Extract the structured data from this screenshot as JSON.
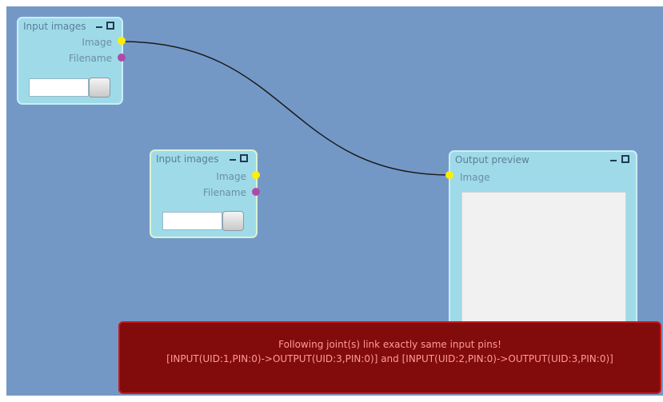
{
  "nodes": {
    "input1": {
      "title": "Input images",
      "pins": [
        "Image",
        "Filename"
      ]
    },
    "input2": {
      "title": "Input images",
      "pins": [
        "Image",
        "Filename"
      ]
    },
    "output": {
      "title": "Output preview",
      "pins": [
        "Image"
      ]
    }
  },
  "error": {
    "line1": "Following joint(s) link exactly same input pins!",
    "line2": "[INPUT(UID:1,PIN:0)->OUTPUT(UID:3,PIN:0)] and [INPUT(UID:2,PIN:0)->OUTPUT(UID:3,PIN:0)]"
  },
  "colors": {
    "canvas": "#7498c6",
    "node": "#9fdae8",
    "image_pin": "#ffee00",
    "filename_pin": "#b04aa8",
    "error_bg": "#820b0b",
    "error_text": "#ff9a9a"
  },
  "icons": {
    "minimize": "minimize-icon",
    "maximize": "maximize-icon",
    "browse": "browse-button"
  }
}
